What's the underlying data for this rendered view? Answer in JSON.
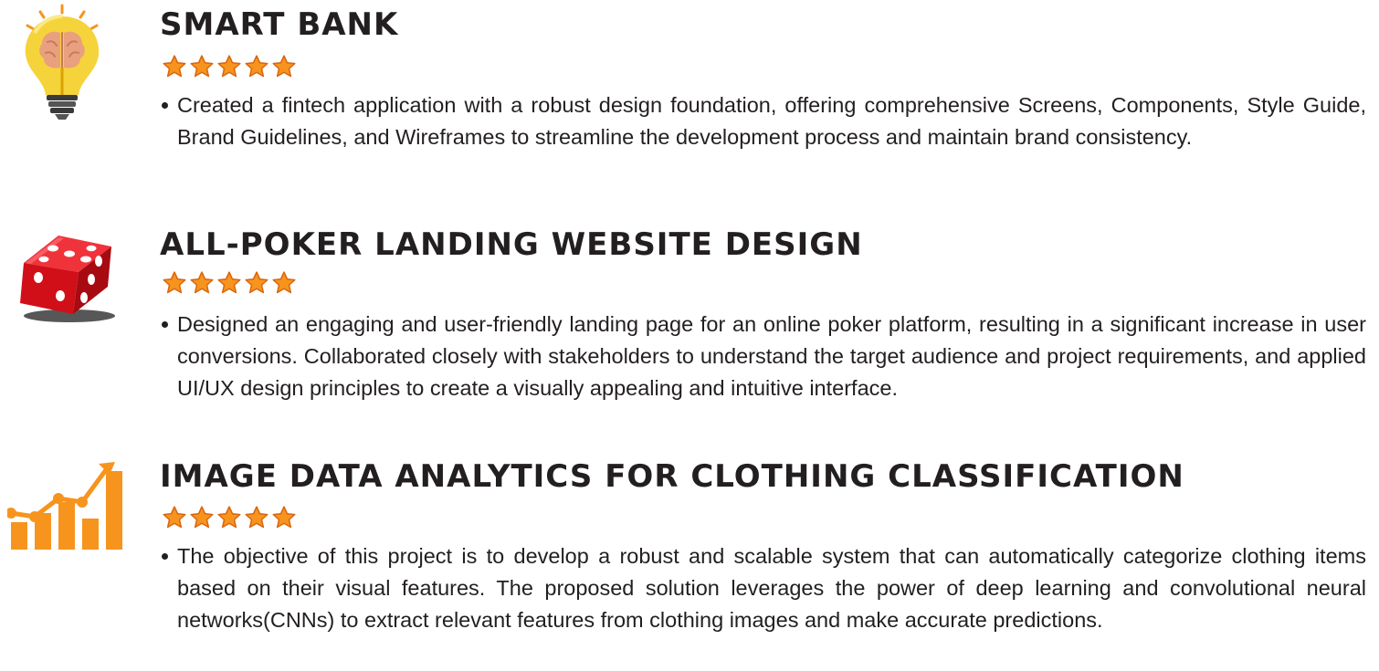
{
  "colors": {
    "text": "#231f20",
    "star": "#f7941d",
    "star_outline": "#d9650e",
    "chart": "#f7941d",
    "dice": "#e2141c",
    "bulb": "#f5d33a"
  },
  "projects": [
    {
      "icon": "lightbulb-brain-icon",
      "title": "SMART BANK",
      "rating": 5,
      "bullets": [
        "Created a fintech application with a robust design foundation, offering comprehensive Screens, Components, Style Guide, Brand Guidelines, and Wireframes to streamline the development process and maintain brand consistency."
      ]
    },
    {
      "icon": "dice-icon",
      "title": "ALL-POKER LANDING WEBSITE DESIGN",
      "rating": 5,
      "bullets": [
        "Designed an engaging and user-friendly landing page for an online poker platform, resulting in a significant increase in user conversions. Collaborated closely with stakeholders to understand the target audience and project requirements, and applied UI/UX design principles to create a visually appealing and intuitive interface."
      ]
    },
    {
      "icon": "growth-chart-icon",
      "title": "IMAGE DATA ANALYTICS FOR CLOTHING CLASSIFICATION",
      "rating": 5,
      "bullets": [
        "The objective of this project is to develop a robust and scalable system that can automatically categorize clothing items based on their visual features. The proposed solution leverages the power of deep learning and convolutional neural networks(CNNs) to extract relevant features from clothing images and make accurate predictions."
      ]
    }
  ]
}
